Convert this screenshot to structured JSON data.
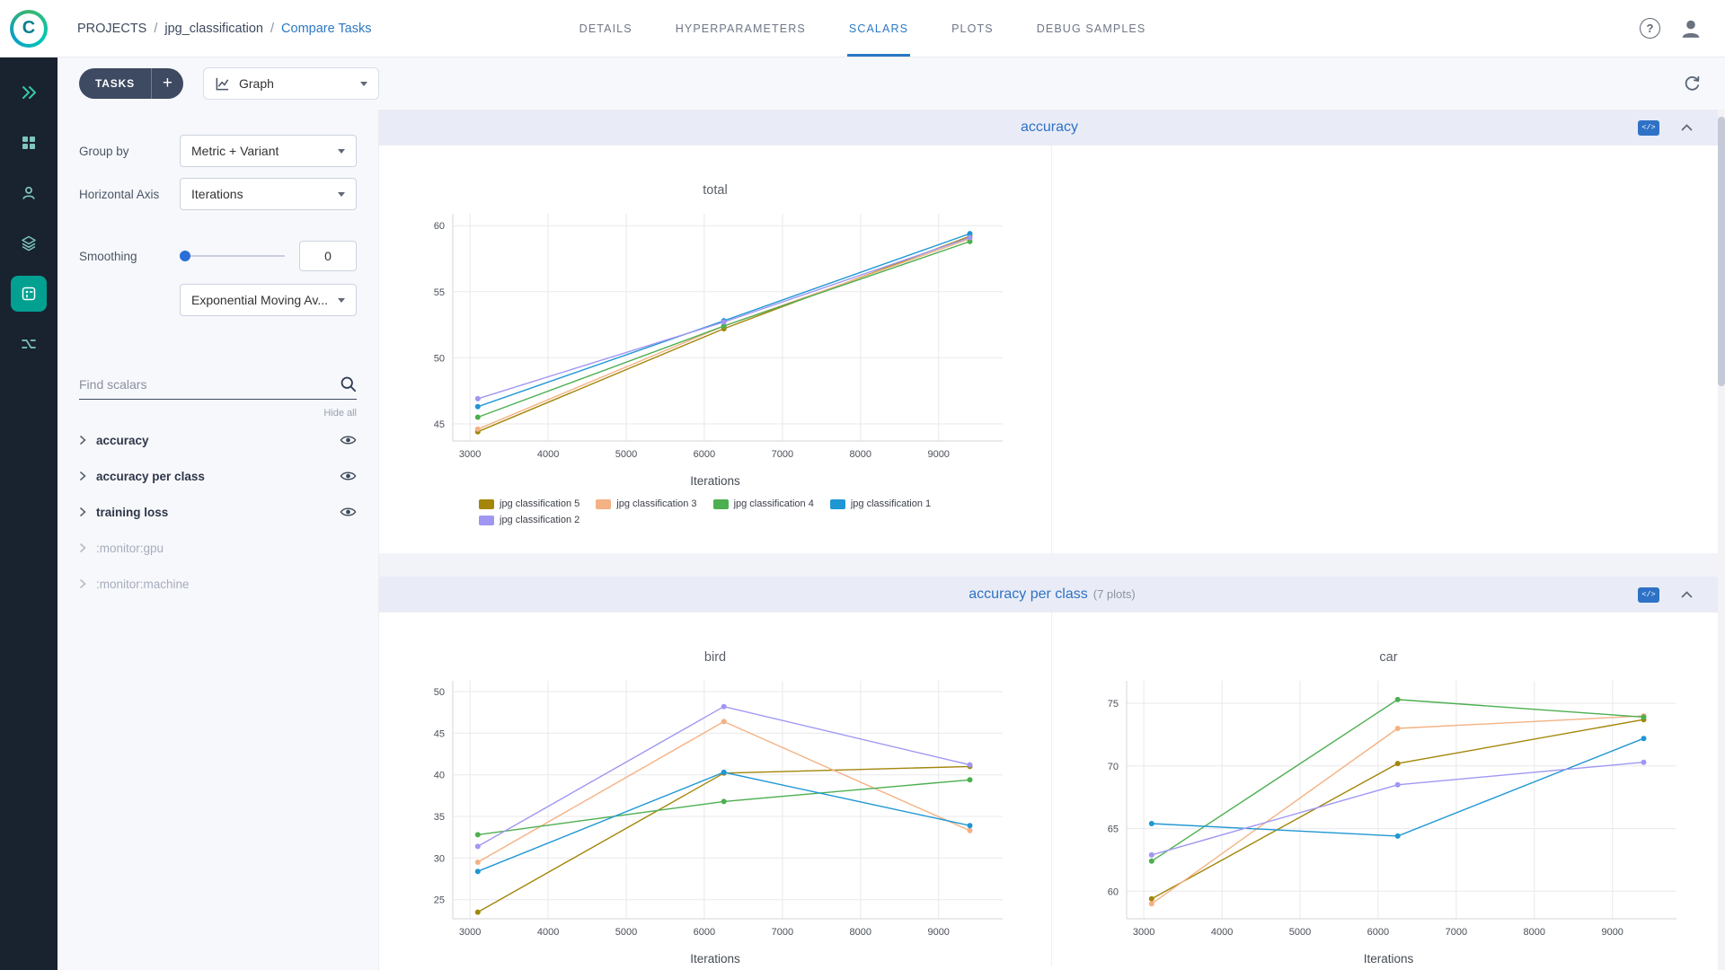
{
  "colors": {
    "accent_blue": "#2b78c2",
    "rail_bg": "#19222f",
    "rail_teal": "#4cb0a6",
    "active_icon_bg": "#02a091",
    "section_header_bg": "#e9ecf6",
    "panel_bg": "#f7f8fb"
  },
  "header": {
    "logo_letter": "C",
    "breadcrumb": {
      "items": [
        "PROJECTS",
        "jpg_classification",
        "Compare Tasks"
      ],
      "separator": "/"
    },
    "tabs": [
      {
        "label": "DETAILS",
        "active": false
      },
      {
        "label": "HYPERPARAMETERS",
        "active": false
      },
      {
        "label": "SCALARS",
        "active": true
      },
      {
        "label": "PLOTS",
        "active": false
      },
      {
        "label": "DEBUG SAMPLES",
        "active": false
      }
    ],
    "help_glyph": "?"
  },
  "toolbar": {
    "tasks_label": "TASKS",
    "add_label": "+",
    "view_value": "Graph"
  },
  "rail_icons": [
    "expand-nav",
    "dashboard",
    "workers-queues",
    "datasets",
    "experiments",
    "pipelines"
  ],
  "panel": {
    "group_by_label": "Group by",
    "group_by_value": "Metric + Variant",
    "horizontal_axis_label": "Horizontal Axis",
    "horizontal_axis_value": "Iterations",
    "smoothing_label": "Smoothing",
    "smoothing_value": "0",
    "smoothing_type_value": "Exponential Moving Av...",
    "search_placeholder": "Find scalars",
    "hide_all_label": "Hide all",
    "scalar_groups": [
      {
        "label": "accuracy",
        "visible": true
      },
      {
        "label": "accuracy per class",
        "visible": true
      },
      {
        "label": "training loss",
        "visible": true
      },
      {
        "label": ":monitor:gpu",
        "visible": false
      },
      {
        "label": ":monitor:machine",
        "visible": false
      }
    ]
  },
  "sections": [
    {
      "title": "accuracy",
      "subtitle": "",
      "code_badge": "</>"
    },
    {
      "title": "accuracy per class",
      "subtitle": "(7 plots)",
      "code_badge": "</>"
    }
  ],
  "chart_data": [
    {
      "type": "line",
      "title": "total",
      "xlabel": "Iterations",
      "x": [
        3100,
        6250,
        9400
      ],
      "xticks": [
        3000,
        4000,
        5000,
        6000,
        7000,
        8000,
        9000
      ],
      "xlim": [
        2780,
        9820
      ],
      "yticks": [
        45,
        50,
        55,
        60
      ],
      "ylim": [
        43.7,
        60.9
      ],
      "grid": true,
      "legend": true,
      "legend_position": "bottom",
      "series": [
        {
          "name": "jpg classification 5",
          "color": "#a3860a",
          "values": [
            44.4,
            52.2,
            59.2
          ]
        },
        {
          "name": "jpg classification 3",
          "color": "#f4b183",
          "values": [
            44.6,
            52.4,
            59.0
          ]
        },
        {
          "name": "jpg classification 4",
          "color": "#4caf50",
          "values": [
            45.5,
            52.4,
            58.8
          ]
        },
        {
          "name": "jpg classification 1",
          "color": "#1f97d3",
          "values": [
            46.3,
            52.8,
            59.4
          ]
        },
        {
          "name": "jpg classification 2",
          "color": "#9f97f2",
          "values": [
            46.9,
            52.7,
            59.1
          ]
        }
      ]
    },
    {
      "type": "line",
      "title": "bird",
      "xlabel": "Iterations",
      "x": [
        3100,
        6250,
        9400
      ],
      "xticks": [
        3000,
        4000,
        5000,
        6000,
        7000,
        8000,
        9000
      ],
      "xlim": [
        2780,
        9820
      ],
      "yticks": [
        25,
        30,
        35,
        40,
        45,
        50
      ],
      "ylim": [
        22.7,
        51.3
      ],
      "grid": true,
      "legend": false,
      "series": [
        {
          "name": "jpg classification 5",
          "color": "#a3860a",
          "values": [
            23.5,
            40.2,
            41.0
          ]
        },
        {
          "name": "jpg classification 3",
          "color": "#f4b183",
          "values": [
            29.5,
            46.4,
            33.3
          ]
        },
        {
          "name": "jpg classification 4",
          "color": "#4caf50",
          "values": [
            32.8,
            36.8,
            39.4
          ]
        },
        {
          "name": "jpg classification 1",
          "color": "#1f97d3",
          "values": [
            28.4,
            40.3,
            33.9
          ]
        },
        {
          "name": "jpg classification 2",
          "color": "#9f97f2",
          "values": [
            31.4,
            48.2,
            41.2
          ]
        }
      ]
    },
    {
      "type": "line",
      "title": "car",
      "xlabel": "Iterations",
      "x": [
        3100,
        6250,
        9400
      ],
      "xticks": [
        3000,
        4000,
        5000,
        6000,
        7000,
        8000,
        9000
      ],
      "xlim": [
        2780,
        9820
      ],
      "yticks": [
        60,
        65,
        70,
        75
      ],
      "ylim": [
        57.8,
        76.8
      ],
      "grid": true,
      "legend": false,
      "series": [
        {
          "name": "jpg classification 5",
          "color": "#a3860a",
          "values": [
            59.4,
            70.2,
            73.7
          ]
        },
        {
          "name": "jpg classification 3",
          "color": "#f4b183",
          "values": [
            59.0,
            73.0,
            74.0
          ]
        },
        {
          "name": "jpg classification 4",
          "color": "#4caf50",
          "values": [
            62.4,
            75.3,
            73.9
          ]
        },
        {
          "name": "jpg classification 1",
          "color": "#1f97d3",
          "values": [
            65.4,
            64.4,
            72.2
          ]
        },
        {
          "name": "jpg classification 2",
          "color": "#9f97f2",
          "values": [
            62.9,
            68.5,
            70.3
          ]
        }
      ]
    }
  ]
}
